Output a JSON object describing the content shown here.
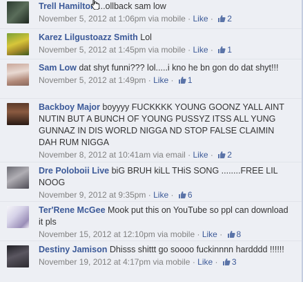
{
  "comments": [
    {
      "author": "Trell Hamilton",
      "text": "...ollback sam low",
      "date": "November 5, 2012 at 1:06pm",
      "via": "via mobile",
      "like": "Like",
      "likes": "2"
    },
    {
      "author": "Karez Lilgustoazz Smith",
      "text": "Lol",
      "date": "November 5, 2012 at 1:45pm",
      "via": "via mobile",
      "like": "Like",
      "likes": "1"
    },
    {
      "author": "Sam Low",
      "text": "dat shyt funni??? lol.....i kno he bn gon do dat shyt!!!",
      "date": "November 5, 2012 at 1:49pm",
      "via": "",
      "like": "Like",
      "likes": "1"
    },
    {
      "author": "Backboy Major",
      "text": "boyyyy FUCKKKK YOUNG GOONZ YALL AINT NUTIN BUT A BUNCH OF YOUNG PUSSYZ ITSS ALL YUNG GUNNAZ IN DIS WORLD NIGGA ND STOP FALSE CLAIMIN DAH RUM NIGGA",
      "date": "November 8, 2012 at 10:41am",
      "via": "via email",
      "like": "Like",
      "likes": "2"
    },
    {
      "author": "Dre Poloboii Live",
      "text": "biG BRUH kiLL THiS SONG ........FREE LIL NOOG",
      "date": "November 9, 2012 at 9:35pm",
      "via": "",
      "like": "Like",
      "likes": "6"
    },
    {
      "author": "Ter'Rene McGee",
      "text": "Mook put this on YouTube so ppl can download it pls",
      "date": "November 15, 2012 at 12:10pm",
      "via": "via mobile",
      "like": "Like",
      "likes": "8"
    },
    {
      "author": "Destiny Jamison",
      "text": "Dhisss shittt go soooo fuckinnnn hardddd !!!!!!",
      "date": "November 19, 2012 at 4:17pm",
      "via": "via mobile",
      "like": "Like",
      "likes": "3"
    }
  ]
}
